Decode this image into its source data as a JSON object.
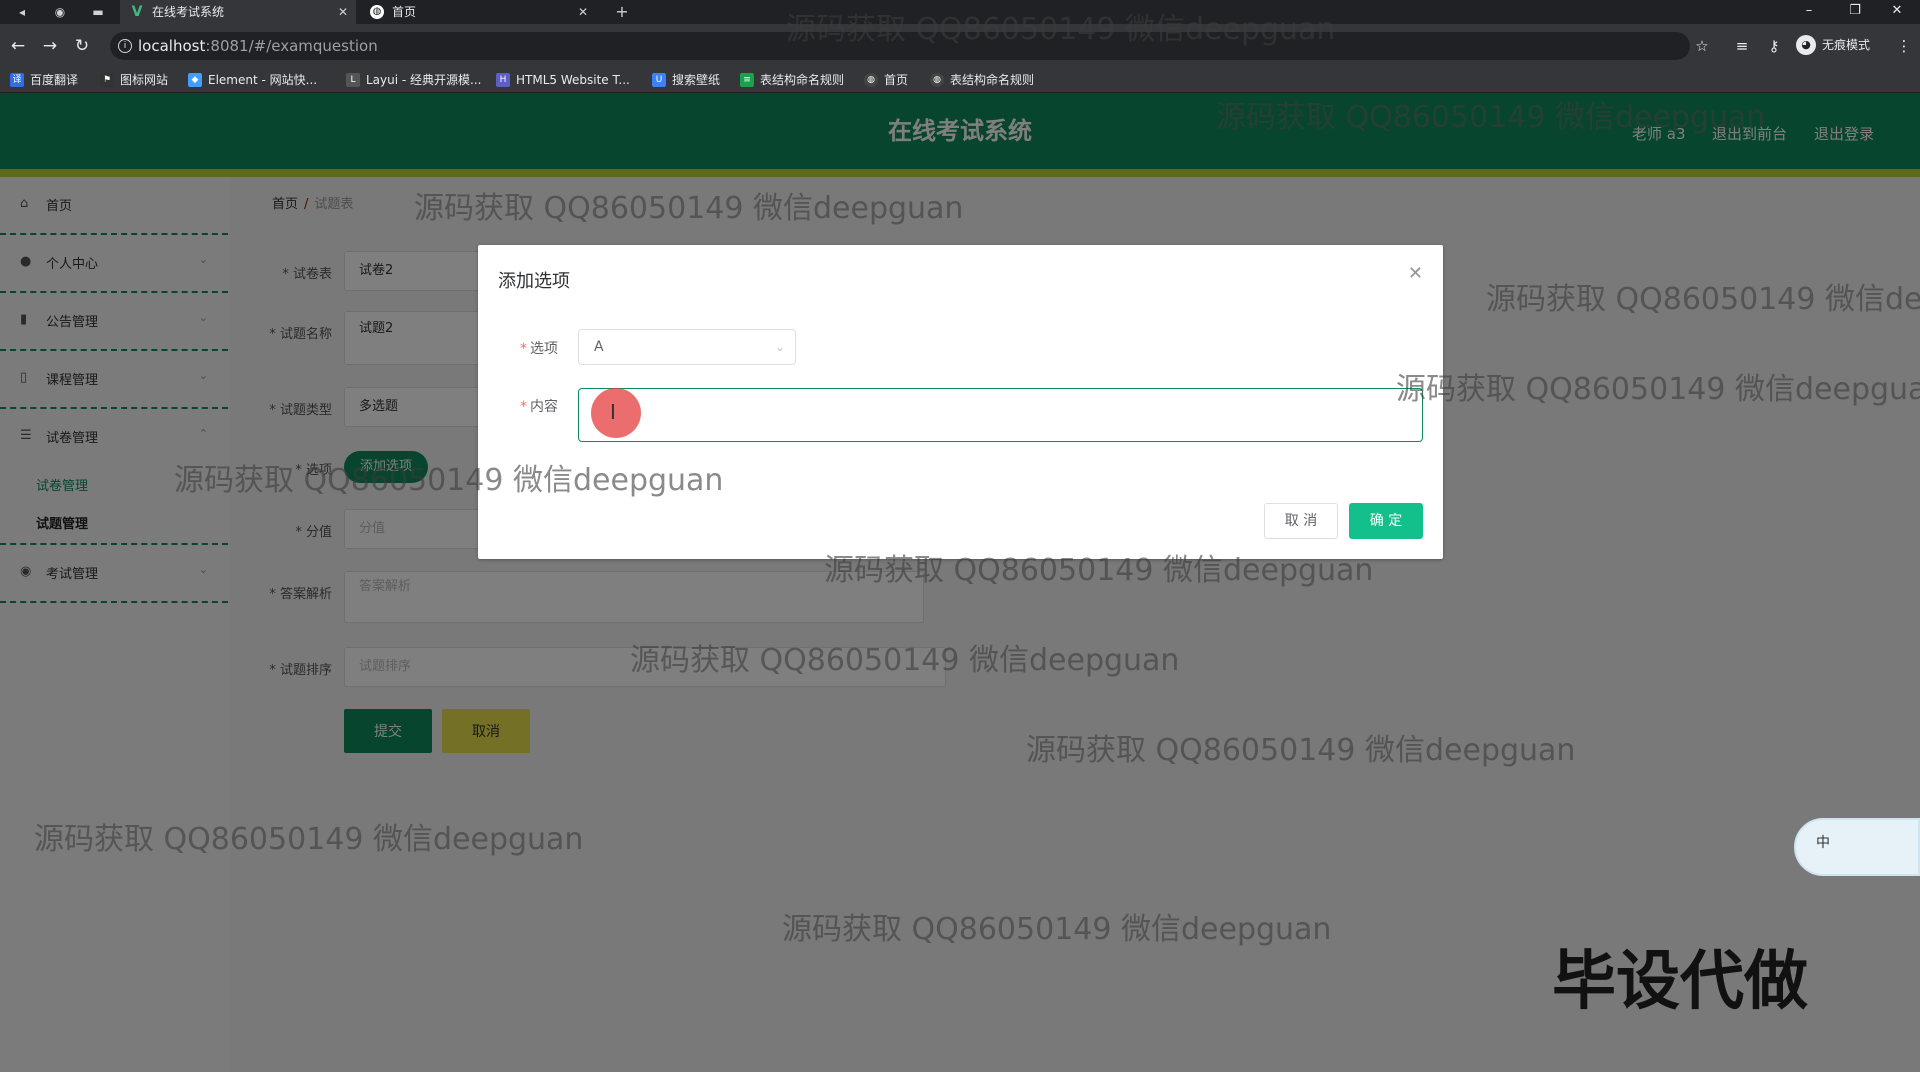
{
  "browser": {
    "tabs": [
      {
        "label": "在线考试系统",
        "active": true,
        "icon": "vue-icon"
      },
      {
        "label": "首页",
        "active": false,
        "icon": "globe-icon"
      }
    ],
    "url_host": "localhost",
    "url_port_path": ":8081/#/examquestion",
    "incognito_label": "无痕模式",
    "bookmarks": [
      {
        "label": "百度翻译",
        "color": "#2f6fe4"
      },
      {
        "label": "图标网站",
        "color": "#333333"
      },
      {
        "label": "Element - 网站快...",
        "color": "#409eff"
      },
      {
        "label": "Layui - 经典开源模...",
        "color": "#555555"
      },
      {
        "label": "HTML5 Website T...",
        "color": "#5b5fc7"
      },
      {
        "label": "搜索壁纸",
        "color": "#3b82f6"
      },
      {
        "label": "表结构命名规则",
        "color": "#16a34a"
      },
      {
        "label": "首页",
        "color": "#444444"
      },
      {
        "label": "表结构命名规则",
        "color": "#444444"
      }
    ]
  },
  "header": {
    "title": "在线考试系统",
    "user": "老师 a3",
    "back_to_admin": "退出到前台",
    "logout": "退出登录"
  },
  "sidebar": {
    "items": [
      {
        "label": "首页",
        "icon": "home-icon"
      },
      {
        "label": "个人中心",
        "icon": "user-icon"
      },
      {
        "label": "公告管理",
        "icon": "chart-icon"
      },
      {
        "label": "课程管理",
        "icon": "phone-icon"
      },
      {
        "label": "试卷管理",
        "icon": "list-icon"
      },
      {
        "label": "考试管理",
        "icon": "pin-icon"
      }
    ],
    "subitems": [
      {
        "label": "试卷管理",
        "current": false
      },
      {
        "label": "试题管理",
        "current": true
      }
    ]
  },
  "breadcrumb": {
    "home": "首页",
    "current": "试题表"
  },
  "form": {
    "paper_label": "试卷表",
    "paper_value": "试卷2",
    "name_label": "试题名称",
    "name_value": "试题2",
    "type_label": "试题类型",
    "type_value": "多选题",
    "option_label": "选项",
    "option_tag": "添加选项",
    "score_label": "分值",
    "score_placeholder": "分值",
    "analysis_label": "答案解析",
    "analysis_placeholder": "答案解析",
    "order_label": "试题排序",
    "order_placeholder": "试题排序",
    "submit": "提交",
    "cancel": "取消"
  },
  "dialog": {
    "title": "添加选项",
    "option_label": "选项",
    "option_value": "A",
    "content_label": "内容",
    "content_value": "",
    "cancel": "取 消",
    "confirm": "确 定"
  },
  "overlays": {
    "watermark": "源码获取 QQ86050149 微信deepguan",
    "promo": "毕设代做",
    "ime_label": "中"
  },
  "colors": {
    "brand": "#0e8a5c",
    "header_accent": "#b9d538",
    "confirm_button": "#13c08c",
    "cancel_button": "#e8e04a"
  }
}
